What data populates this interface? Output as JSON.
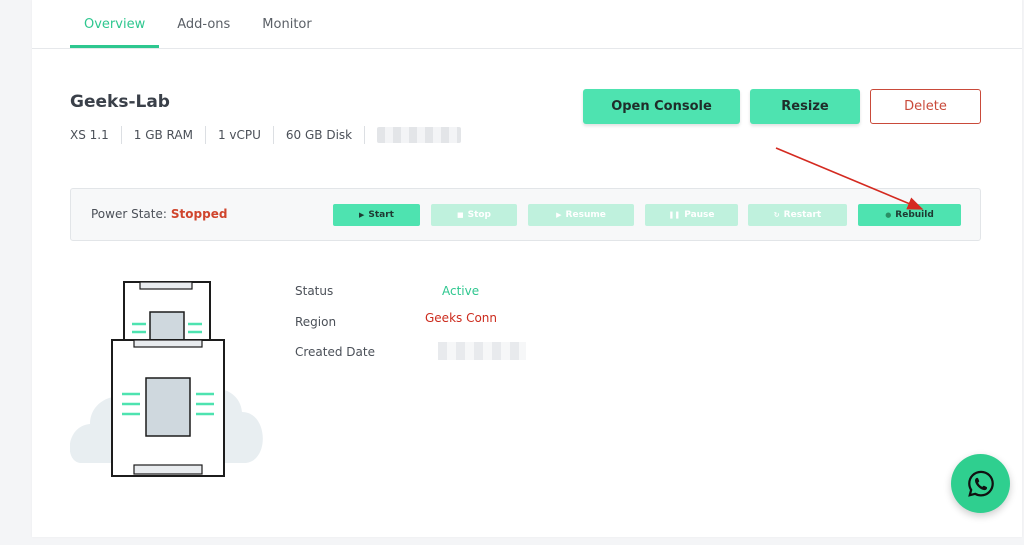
{
  "tabs": [
    {
      "label": "Overview",
      "active": true
    },
    {
      "label": "Add-ons",
      "active": false
    },
    {
      "label": "Monitor",
      "active": false
    }
  ],
  "server": {
    "name": "Geeks-Lab",
    "specs": [
      "XS 1.1",
      "1 GB RAM",
      "1 vCPU",
      "60 GB Disk"
    ]
  },
  "actions": {
    "open_console": "Open Console",
    "resize": "Resize",
    "delete": "Delete"
  },
  "power": {
    "label": "Power State:",
    "state": "Stopped",
    "buttons": [
      {
        "label": "Start",
        "enabled": true
      },
      {
        "label": "Stop",
        "enabled": false
      },
      {
        "label": "Resume",
        "enabled": false
      },
      {
        "label": "Pause",
        "enabled": false
      },
      {
        "label": "Restart",
        "enabled": false
      },
      {
        "label": "Rebuild",
        "enabled": true
      }
    ]
  },
  "details": {
    "status_label": "Status",
    "status_value": "Active",
    "region_label": "Region",
    "region_value": "Geeks Conn",
    "created_label": "Created Date"
  },
  "colors": {
    "accent": "#2ec78f",
    "button_green": "#4ee3b0",
    "danger": "#c94a3a",
    "stopped": "#d0452d",
    "region": "#cc2b1d",
    "arrow": "#d42a20"
  },
  "icons": {
    "whatsapp": "whatsapp-icon"
  }
}
